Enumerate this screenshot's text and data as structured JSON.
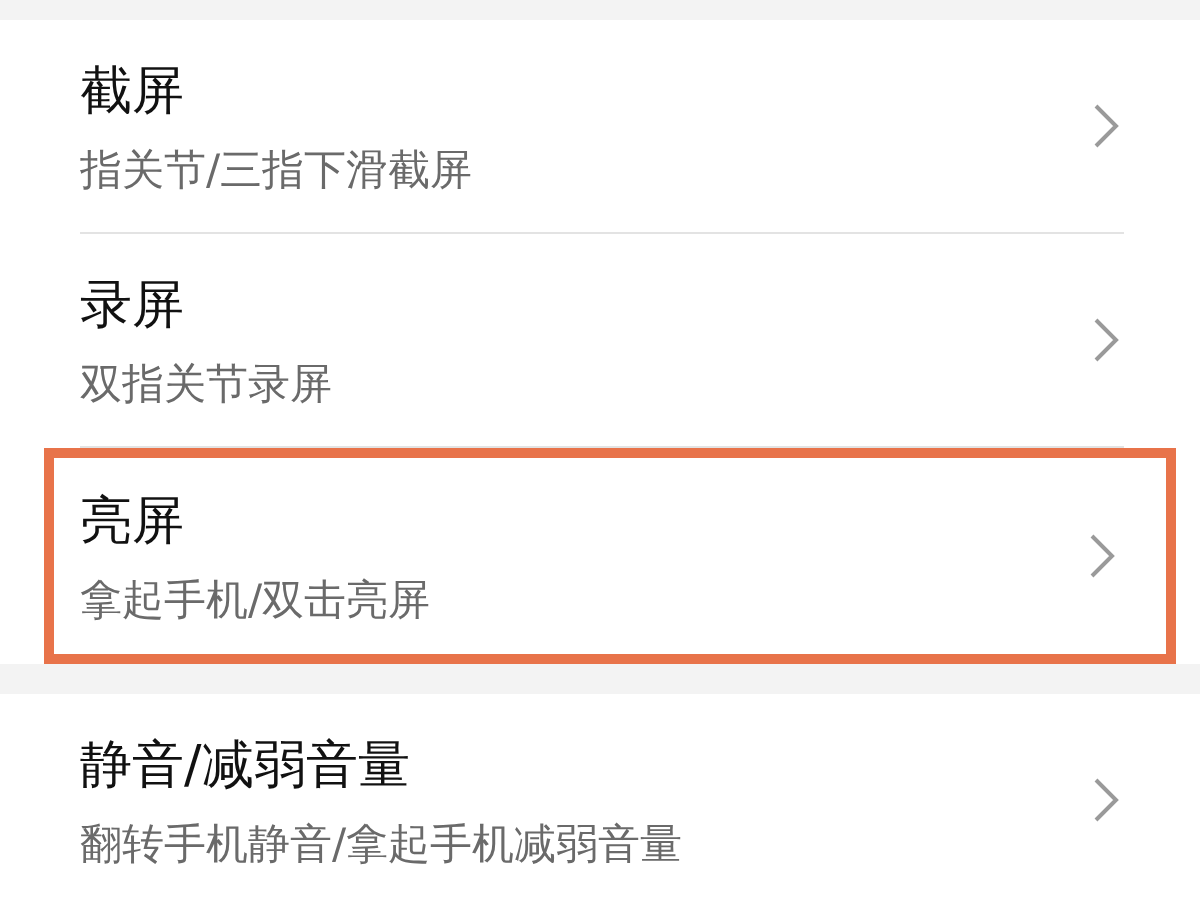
{
  "groups": [
    {
      "items": [
        {
          "title": "截屏",
          "subtitle": "指关节/三指下滑截屏",
          "highlighted": false
        },
        {
          "title": "录屏",
          "subtitle": "双指关节录屏",
          "highlighted": false
        },
        {
          "title": "亮屏",
          "subtitle": "拿起手机/双击亮屏",
          "highlighted": true
        }
      ]
    },
    {
      "items": [
        {
          "title": "静音/减弱音量",
          "subtitle": "翻转手机静音/拿起手机减弱音量",
          "highlighted": false
        }
      ]
    }
  ]
}
